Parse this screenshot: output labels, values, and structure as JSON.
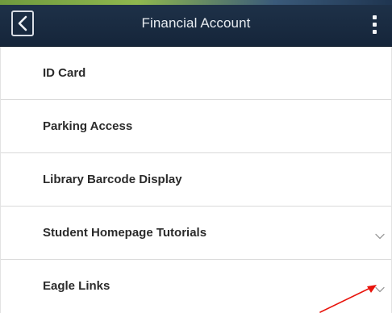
{
  "header": {
    "title": "Financial Account",
    "back_icon": "chevron-left-icon",
    "more_icon": "more-vertical-icon"
  },
  "list": {
    "items": [
      {
        "label": "ID Card",
        "expandable": false
      },
      {
        "label": "Parking Access",
        "expandable": false
      },
      {
        "label": "Library Barcode Display",
        "expandable": false
      },
      {
        "label": "Student Homepage Tutorials",
        "expandable": true,
        "icon": "chevron-down-icon"
      },
      {
        "label": "Eagle Links",
        "expandable": true,
        "icon": "chevron-down-icon"
      }
    ]
  },
  "colors": {
    "header_bg": "#1b2d44",
    "header_text": "#e8ecf1",
    "item_text": "#2b2b2b",
    "divider": "#d9d9d9",
    "annotation_arrow": "#e8140c"
  }
}
